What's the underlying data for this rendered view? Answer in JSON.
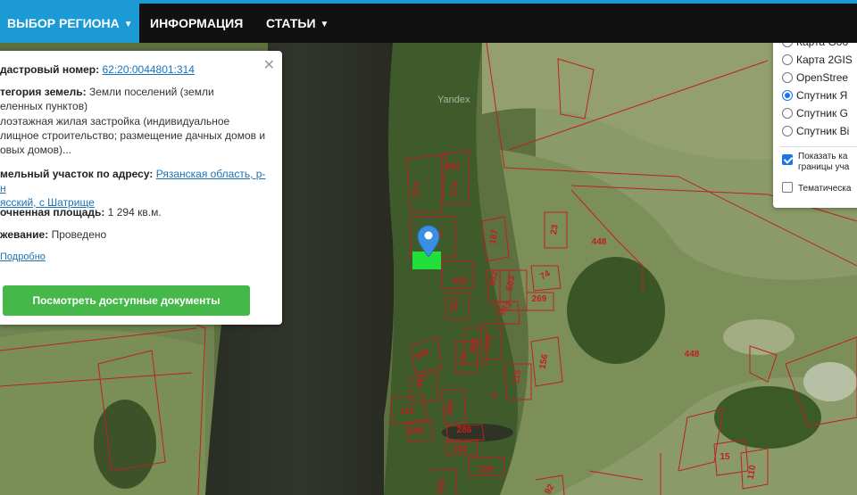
{
  "nav": {
    "region_label": "ВЫБОР РЕГИОНА",
    "info_label": "ИНФОРМАЦИЯ",
    "articles_label": "СТАТЬИ"
  },
  "map": {
    "provider_watermark": "Yandex",
    "parcels": [
      "897",
      "277",
      "174",
      "8",
      "167",
      "23",
      "448",
      "352",
      "502",
      "503",
      "74",
      "269",
      "151",
      "263",
      "178",
      "498",
      "346",
      "171",
      "156",
      "491",
      "115",
      "448",
      "3",
      "111",
      "560",
      "286",
      "508",
      "261",
      "128",
      "15",
      "110",
      "105",
      "92"
    ]
  },
  "popup": {
    "cadastral_label": "дастровый номер:",
    "cadastral_value": "62:20:0044801:314",
    "category_label": "тегория земель:",
    "category_value_1": "Земли поселений (земли",
    "category_value_2": "еленных пунктов)",
    "use_1": "лоэтажная жилая застройка (индивидуальное",
    "use_2": "лищное строительство; размещение дачных домов и",
    "use_3": "овых домов)...",
    "address_label": "мельный участок по адресу:",
    "address_value_1": "Рязанская область, р-н",
    "address_value_2": "ясский, с Шатрище",
    "area_label": "очненная площадь:",
    "area_value": "1 294 кв.м.",
    "survey_label": "жевание:",
    "survey_value": "Проведено",
    "more_link": "Подробно",
    "docs_button": "Посмотреть доступные документы"
  },
  "layers": {
    "options": [
      {
        "label": "Карта Goo",
        "checked": false
      },
      {
        "label": "Карта 2GIS",
        "checked": false
      },
      {
        "label": "OpenStree",
        "checked": false
      },
      {
        "label": "Спутник Я",
        "checked": true
      },
      {
        "label": "Спутник G",
        "checked": false
      },
      {
        "label": "Спутник Bi",
        "checked": false
      }
    ],
    "show_boundaries_1": "Показать ка",
    "show_boundaries_2": "границы уча",
    "thematic": "Тематическа"
  },
  "colors": {
    "nav_bg": "#111111",
    "nav_active": "#1b9ad6",
    "button_green": "#46b84a",
    "parcel_red": "#c02020",
    "selected_parcel": "#22e03a",
    "marker_blue": "#3b8fe0"
  }
}
